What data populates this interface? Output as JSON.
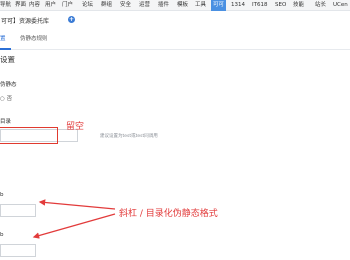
{
  "topnav": {
    "items": [
      "导航",
      "界面",
      "内容",
      "用户",
      "门户",
      "论坛",
      "群组",
      "安全",
      "运营",
      "插件",
      "模板",
      "工具",
      "可可",
      "1314",
      "IT618",
      "SEO",
      "技能",
      "站长",
      "UCen"
    ],
    "active_index": 12,
    "accent_color": "#4a90e2"
  },
  "page": {
    "title": "可可】资源委托库",
    "add_icon": "plus-circle-icon"
  },
  "tabs": {
    "items": [
      "置",
      "伪静态规则"
    ],
    "active_index": 0
  },
  "section": {
    "title": "设置"
  },
  "fields": {
    "static_label": "伪静态",
    "radio_text": "否",
    "dir_label": "目录",
    "dir_hint": "建议设置为test或test同调用",
    "label_c": "b",
    "label_d": "b"
  },
  "annotations": {
    "liukong": "留空",
    "main": "斜杠 /  目录化伪静态格式",
    "color": "#e23b3b"
  }
}
